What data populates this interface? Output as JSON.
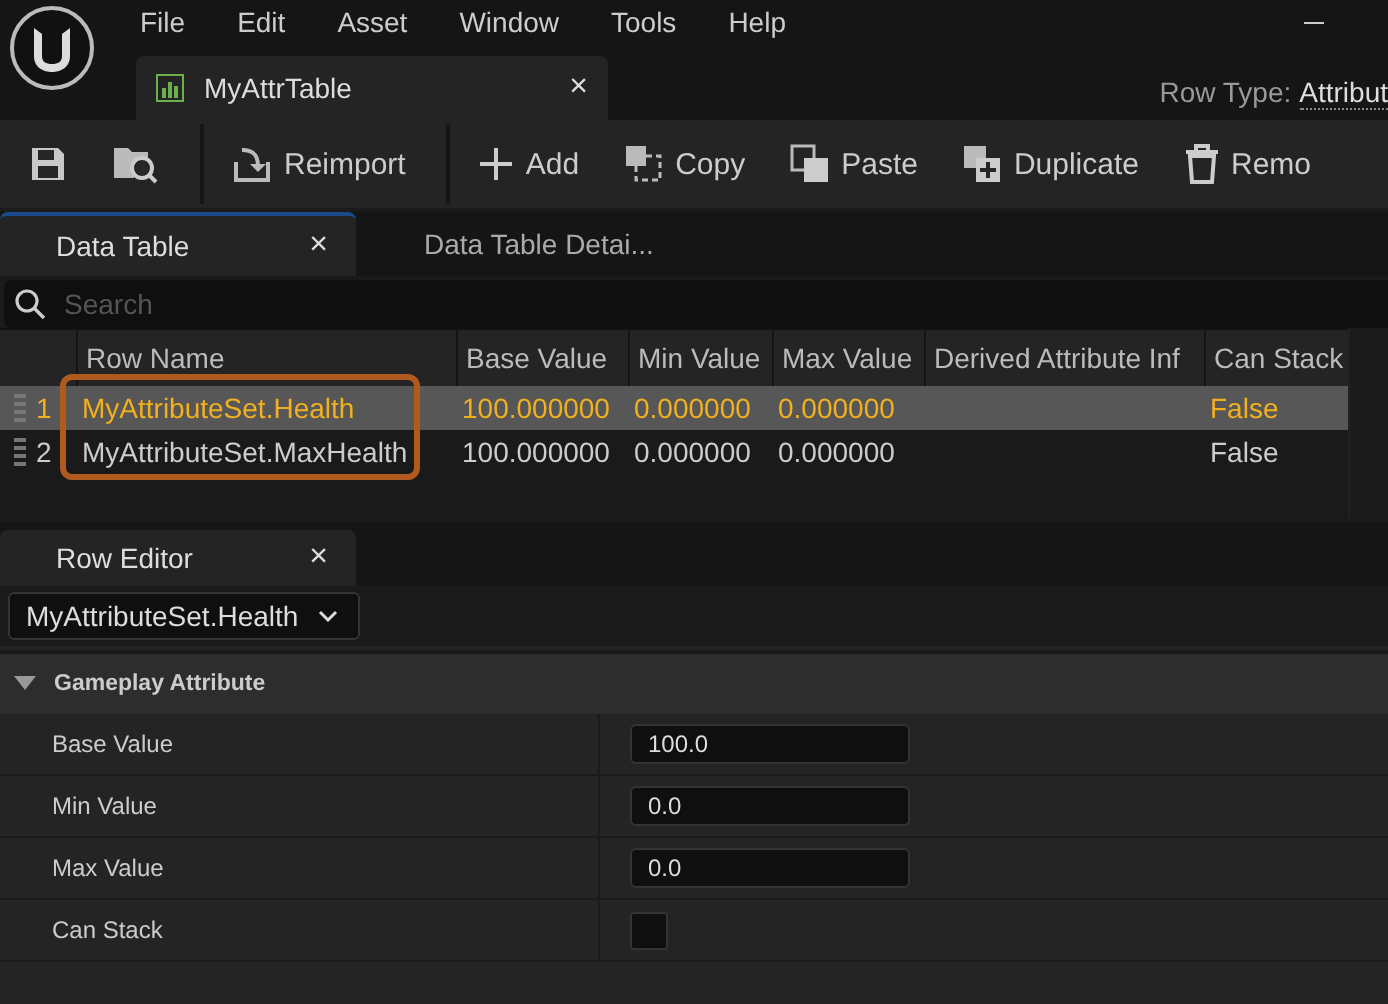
{
  "menu": [
    "File",
    "Edit",
    "Asset",
    "Window",
    "Tools",
    "Help"
  ],
  "doc_tab": {
    "title": "MyAttrTable",
    "close": "×"
  },
  "row_type": {
    "label": "Row Type:",
    "value": "Attribut"
  },
  "toolbar": [
    {
      "kind": "save"
    },
    {
      "kind": "browse"
    },
    {
      "kind": "reimport",
      "label": "Reimport"
    },
    {
      "kind": "add",
      "label": "Add"
    },
    {
      "kind": "copy",
      "label": "Copy"
    },
    {
      "kind": "paste",
      "label": "Paste"
    },
    {
      "kind": "duplicate",
      "label": "Duplicate"
    },
    {
      "kind": "remove",
      "label": "Remo"
    }
  ],
  "panel_tabs": [
    {
      "label": "Data Table",
      "close": "×",
      "selected": true
    },
    {
      "label": "Data Table Detai...",
      "selected": false
    }
  ],
  "search": {
    "placeholder": "Search"
  },
  "table": {
    "columns": [
      "Row Name",
      "Base Value",
      "Min Value",
      "Max Value",
      "Derived Attribute Inf",
      "Can Stack"
    ],
    "rows": [
      {
        "index": "1",
        "cells": [
          "MyAttributeSet.Health",
          "100.000000",
          "0.000000",
          "0.000000",
          "",
          "False"
        ],
        "selected": true
      },
      {
        "index": "2",
        "cells": [
          "MyAttributeSet.MaxHealth",
          "100.000000",
          "0.000000",
          "0.000000",
          "",
          "False"
        ],
        "selected": false
      }
    ]
  },
  "row_editor": {
    "tab": "Row Editor",
    "close": "×",
    "row_select": "MyAttributeSet.Health",
    "category": "Gameplay Attribute",
    "expanded": true,
    "properties": [
      {
        "kind": "number",
        "label": "Base Value",
        "value": "100.0"
      },
      {
        "kind": "number",
        "label": "Min Value",
        "value": "0.0"
      },
      {
        "kind": "number",
        "label": "Max Value",
        "value": "0.0"
      },
      {
        "kind": "checkbox",
        "label": "Can Stack",
        "checked": false
      }
    ]
  }
}
